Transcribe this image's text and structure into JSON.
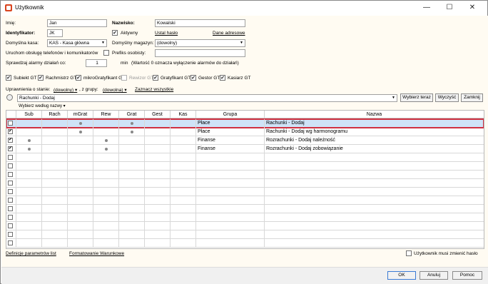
{
  "window": {
    "title": "Użytkownik",
    "minimize": "—",
    "maximize": "☐",
    "close": "✕"
  },
  "form": {
    "imie_label": "Imię:",
    "imie_value": "Jan",
    "nazwisko_label": "Nazwisko:",
    "nazwisko_value": "Kowalski",
    "identyfikator_label": "Identyfikator:",
    "identyfikator_value": "JK",
    "aktywny_label": "Aktywny",
    "aktywny_checked": true,
    "ustal_haslo": "Ustal hasło",
    "dane_adresowe": "Dane adresowe",
    "kasa_label": "Domyślna kasa:",
    "kasa_value": "KAS - Kasa główna",
    "magazyn_label": "Domyślny magazyn:",
    "magazyn_value": "(dowolny)",
    "telefon_label": "Uruchom obsługę telefonów i komunikatorów",
    "telefon_checked": false,
    "prefiks_label": "Prefiks osobisty:",
    "prefiks_value": "",
    "alarmy_label": "Sprawdzaj alarmy działań co:",
    "alarmy_value": "1",
    "alarmy_unit": "min",
    "alarmy_note": "(Wartość 0 oznacza wyłączenie alarmów do działań)"
  },
  "roles": [
    {
      "label": "Subiekt GT",
      "checked": true,
      "disabled": false
    },
    {
      "label": "Rachmistrz GT",
      "checked": true,
      "disabled": false
    },
    {
      "label": "mikroGratyfikant GT",
      "checked": true,
      "disabled": false
    },
    {
      "label": "Rewizor GT",
      "checked": false,
      "disabled": true
    },
    {
      "label": "Gratyfikant GT",
      "checked": true,
      "disabled": false
    },
    {
      "label": "Gestor GT",
      "checked": true,
      "disabled": false
    },
    {
      "label": "Kasiarz GT",
      "checked": true,
      "disabled": false
    }
  ],
  "filters": {
    "stan_label": "Uprawnienia o stanie:",
    "stan_value": "(dowolny)",
    "grupa_label": ", z grupy:",
    "grupa_value": "(dowolna)",
    "zaznacz": "Zaznacz wszystkie",
    "search_value": "Rachunki - Dodaj",
    "wybierz_btn": "Wybierz teraz",
    "wyczysc_btn": "Wyczyść",
    "zamknij_btn": "Zamknij",
    "wybierz_wg": "Wybierz według nazwy"
  },
  "table": {
    "headers": [
      "Sub",
      "Rach",
      "mGrat",
      "Rew",
      "Grat",
      "Gest",
      "Kas",
      "Grupa",
      "Nazwa"
    ],
    "rows": [
      {
        "checked": false,
        "dots": [
          false,
          false,
          true,
          false,
          true,
          false,
          false
        ],
        "grupa": "Płace",
        "nazwa": "Rachunki - Dodaj",
        "selected": true
      },
      {
        "checked": true,
        "dots": [
          false,
          false,
          true,
          false,
          true,
          false,
          false
        ],
        "grupa": "Płace",
        "nazwa": "Rachunki - Dodaj wg harmonogramu",
        "selected": false
      },
      {
        "checked": true,
        "dots": [
          true,
          false,
          false,
          true,
          false,
          false,
          false
        ],
        "grupa": "Finanse",
        "nazwa": "Rozrachunki - Dodaj należność",
        "selected": false
      },
      {
        "checked": true,
        "dots": [
          true,
          false,
          false,
          true,
          false,
          false,
          false
        ],
        "grupa": "Finanse",
        "nazwa": "Rozrachunki - Dodaj zobowiązanie",
        "selected": false
      }
    ],
    "empty_rows": 11
  },
  "bottom": {
    "definicje": "Definicje parametrów list",
    "formatowanie": "Formatowanie Warunkowe",
    "zmien_haslo_label": "Użytkownik musi zmienić hasło",
    "zmien_haslo_checked": false
  },
  "footer": {
    "ok": "OK",
    "anuluj": "Anuluj",
    "pomoc": "Pomoc"
  }
}
